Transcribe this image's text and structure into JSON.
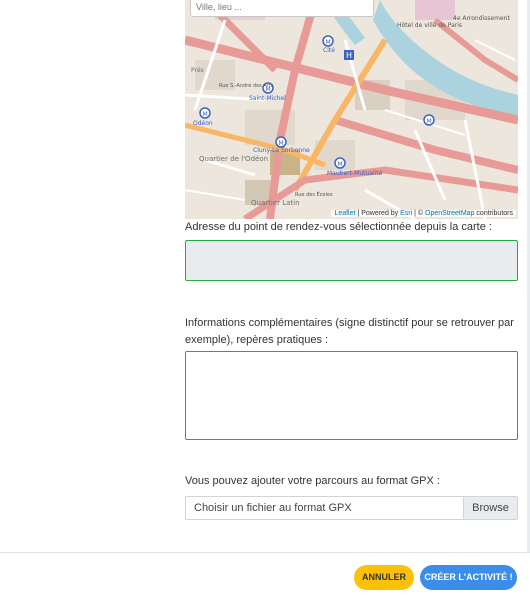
{
  "map": {
    "search_placeholder": "Ville, lieu ...",
    "attribution": {
      "leaflet": "Leaflet",
      "powered_by": "Powered by",
      "esri": "Esri",
      "copyright": "©",
      "osm": "OpenStreetMap",
      "contributors": "contributors"
    },
    "labels": {
      "cite": "Cité",
      "saint_michel": "Saint-Michel",
      "odeon": "Odéon",
      "cluny": "Cluny-La Sorbonne",
      "quartier_odeon": "Quartier de l'Odéon",
      "quartier_latin": "Quartier Latin",
      "maubert": "Maubert-Mutualité",
      "hotel_de_ville": "Hôtel de ville de Paris",
      "arrondissement": "4e Arrondissement",
      "rue_st_andre": "Rue S.-André des Arts",
      "rue_ecoles": "Rue des Écoles",
      "pres": "Prés"
    }
  },
  "address": {
    "label": "Adresse du point de rendez-vous sélectionnée depuis la carte :",
    "value": ""
  },
  "info": {
    "label": "Informations complémentaires (signe distinctif pour se retrouver par exemple), repères pratiques :",
    "value": ""
  },
  "gpx": {
    "label": "Vous pouvez ajouter votre parcours au format GPX :",
    "file_placeholder": "Choisir un fichier au format GPX",
    "browse_label": "Browse"
  },
  "footer": {
    "cancel_label": "ANNULER",
    "create_label": "CRÉER L'ACTIVITÉ !"
  },
  "colors": {
    "cancel_bg": "#ffc107",
    "create_bg": "#3c8dea",
    "valid_border": "#28a745",
    "disabled_bg": "#e9ecef"
  }
}
